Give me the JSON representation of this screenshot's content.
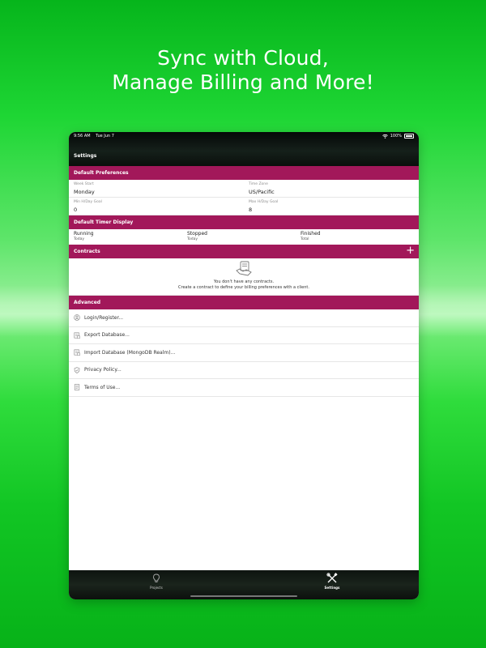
{
  "headline": {
    "line1": "Sync with Cloud,",
    "line2": "Manage Billing and More!"
  },
  "status_bar": {
    "time": "9:56 AM",
    "date": "Tue Jun 7",
    "battery": "100%"
  },
  "nav": {
    "title": "Settings"
  },
  "default_preferences": {
    "header": "Default Preferences",
    "fields": [
      {
        "label": "Week Start",
        "value": "Monday"
      },
      {
        "label": "Time Zone",
        "value": "US/Pacific"
      },
      {
        "label": "Min H/Day Goal",
        "value": "0"
      },
      {
        "label": "Max H/Day Goal",
        "value": "8"
      }
    ]
  },
  "timer_display": {
    "header": "Default Timer Display",
    "columns": [
      {
        "title": "Running",
        "sub": "Today"
      },
      {
        "title": "Stopped",
        "sub": "Today"
      },
      {
        "title": "Finished",
        "sub": "Total"
      }
    ]
  },
  "contracts": {
    "header": "Contracts",
    "add_label": "+",
    "empty_line1": "You don't have any contracts.",
    "empty_line2": "Create a contract to define your billing preferences with a client."
  },
  "advanced": {
    "header": "Advanced",
    "items": [
      {
        "label": "Login/Register...",
        "icon": "person-circle-icon"
      },
      {
        "label": "Export Database...",
        "icon": "database-export-icon"
      },
      {
        "label": "Import Database (MongoDB Realm)...",
        "icon": "database-import-icon"
      },
      {
        "label": "Privacy Policy...",
        "icon": "shield-check-icon"
      },
      {
        "label": "Terms of Use...",
        "icon": "document-icon"
      }
    ]
  },
  "tabbar": {
    "tabs": [
      {
        "label": "Projects",
        "icon": "lightbulb-icon",
        "active": false
      },
      {
        "label": "Settings",
        "icon": "tools-icon",
        "active": true
      }
    ]
  },
  "colors": {
    "accent": "#a2185a",
    "background_green": "#1ed634"
  }
}
